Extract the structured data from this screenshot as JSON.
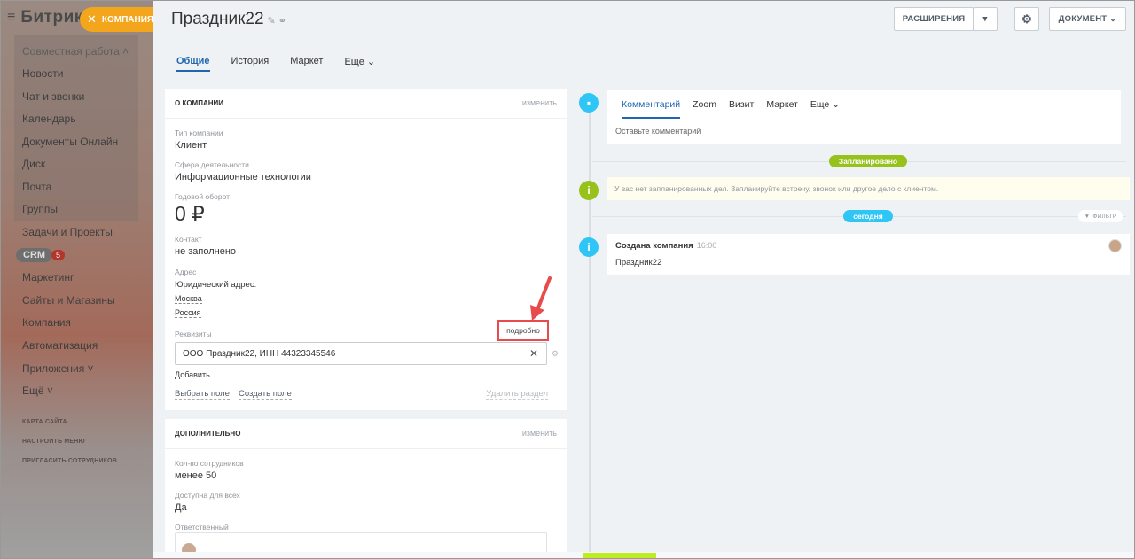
{
  "sidebar": {
    "brand": "Битрикс",
    "section_title": "Совместная работа",
    "items": [
      {
        "label": "Новости"
      },
      {
        "label": "Чат и звонки"
      },
      {
        "label": "Календарь"
      },
      {
        "label": "Документы Онлайн"
      },
      {
        "label": "Диск"
      },
      {
        "label": "Почта"
      },
      {
        "label": "Группы"
      },
      {
        "label": "Задачи и Проекты"
      },
      {
        "label": "Маркетинг"
      },
      {
        "label": "Сайты и Магазины"
      },
      {
        "label": "Компания"
      },
      {
        "label": "Автоматизация"
      },
      {
        "label": "Приложения"
      },
      {
        "label": "Ещё"
      }
    ],
    "crm_label": "CRM",
    "crm_count": "5",
    "small_links": [
      "КАРТА САЙТА",
      "НАСТРОИТЬ МЕНЮ",
      "ПРИГЛАСИТЬ СОТРУДНИКОВ"
    ]
  },
  "chip": {
    "label": "КОМПАНИЯ"
  },
  "header": {
    "title": "Праздник22",
    "extensions_label": "РАСШИРЕНИЯ",
    "document_label": "ДОКУМЕНТ"
  },
  "tabs": [
    "Общие",
    "История",
    "Маркет",
    "Еще"
  ],
  "about": {
    "header": "О КОМПАНИИ",
    "edit": "изменить",
    "company_type_label": "Тип компании",
    "company_type_value": "Клиент",
    "industry_label": "Сфера деятельности",
    "industry_value": "Информационные технологии",
    "revenue_label": "Годовой оборот",
    "revenue_value": "0 ₽",
    "contact_label": "Контакт",
    "contact_value": "не заполнено",
    "address_label": "Адрес",
    "legal_address_label": "Юридический адрес:",
    "city": "Москва",
    "country": "Россия",
    "requisites_label": "Реквизиты",
    "detail_label": "подробно",
    "requisites_value": "ООО Праздник22, ИНН 44323345546",
    "add_label": "Добавить",
    "choose_field": "Выбрать поле",
    "create_field": "Создать поле",
    "delete_section": "Удалить раздел"
  },
  "extra": {
    "header": "ДОПОЛНИТЕЛЬНО",
    "edit": "изменить",
    "employees_label": "Кол-во сотрудников",
    "employees_value": "менее 50",
    "available_label": "Доступна для всех",
    "available_value": "Да",
    "responsible_label": "Ответственный"
  },
  "timeline": {
    "tabs": [
      "Комментарий",
      "Zoom",
      "Визит",
      "Маркет",
      "Еще"
    ],
    "comment_placeholder": "Оставьте комментарий",
    "planned_badge": "Запланировано",
    "planned_text": "У вас нет запланированных дел. Запланируйте встречу, звонок или другое дело с клиентом.",
    "today_badge": "сегодня",
    "filter_label": "ФИЛЬТР",
    "event_title": "Создана компания",
    "event_time": "16:00",
    "event_text": "Праздник22"
  },
  "colors": {
    "accent": "#2067b0",
    "timeline_blue": "#2fc6f6",
    "timeline_green": "#97c21c",
    "highlight_red": "#e84b4b",
    "chip_orange": "#f3a51b"
  }
}
